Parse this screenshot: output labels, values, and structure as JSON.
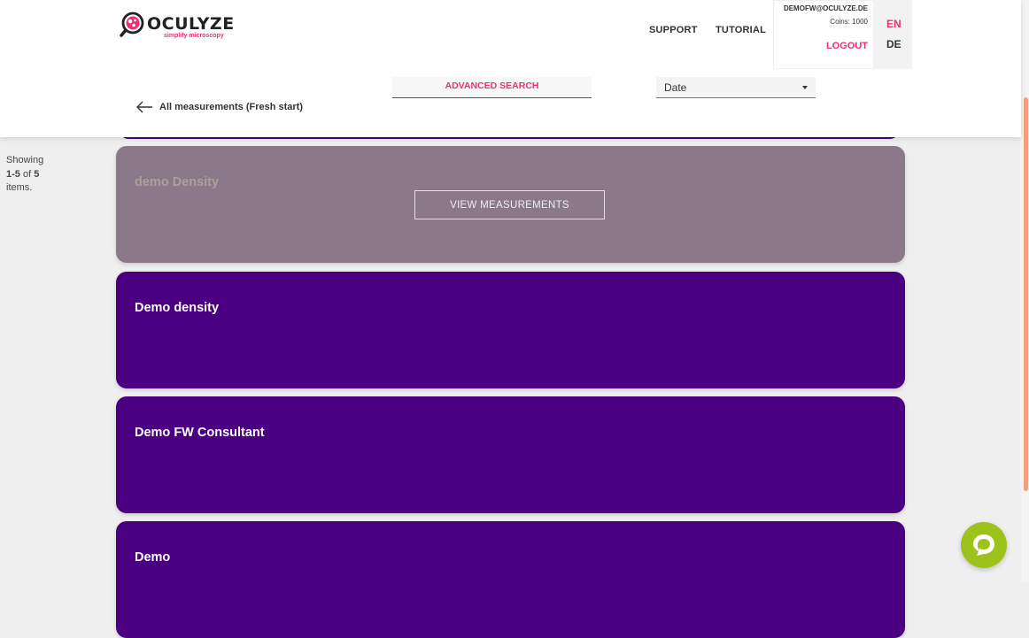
{
  "brand": {
    "name": "OCULYZE",
    "tagline": "simplify microscopy"
  },
  "nav": {
    "support": "SUPPORT",
    "tutorial": "TUTORIAL"
  },
  "account": {
    "email": "DEMOFW@OCULYZE.DE",
    "coins": "Coins: 1000",
    "logout": "LOGOUT"
  },
  "language": {
    "en": "EN",
    "de": "DE",
    "active": "EN"
  },
  "search": {
    "advanced_label": "ADVANCED SEARCH"
  },
  "sort": {
    "selected": "Date"
  },
  "back": {
    "label": "All measurements (Fresh start)"
  },
  "pagination": {
    "prefix": "Showing",
    "range": "1-5",
    "of": "of",
    "total": "5",
    "suffix": "items."
  },
  "cards": [
    {
      "title": "demo Density",
      "button": "VIEW MEASUREMENTS"
    },
    {
      "title": "Demo density"
    },
    {
      "title": "Demo FW Consultant"
    },
    {
      "title": "Demo"
    }
  ],
  "colors": {
    "accent_pink": "#e8336e",
    "card_purple": "#4b0082",
    "card_hover": "#897989",
    "chat_green": "#9bc31c",
    "scroll_orange": "#f0a07a"
  },
  "icons": [
    "logo-icon",
    "arrow-left-icon",
    "caret-down-icon",
    "chat-bubble-icon"
  ]
}
